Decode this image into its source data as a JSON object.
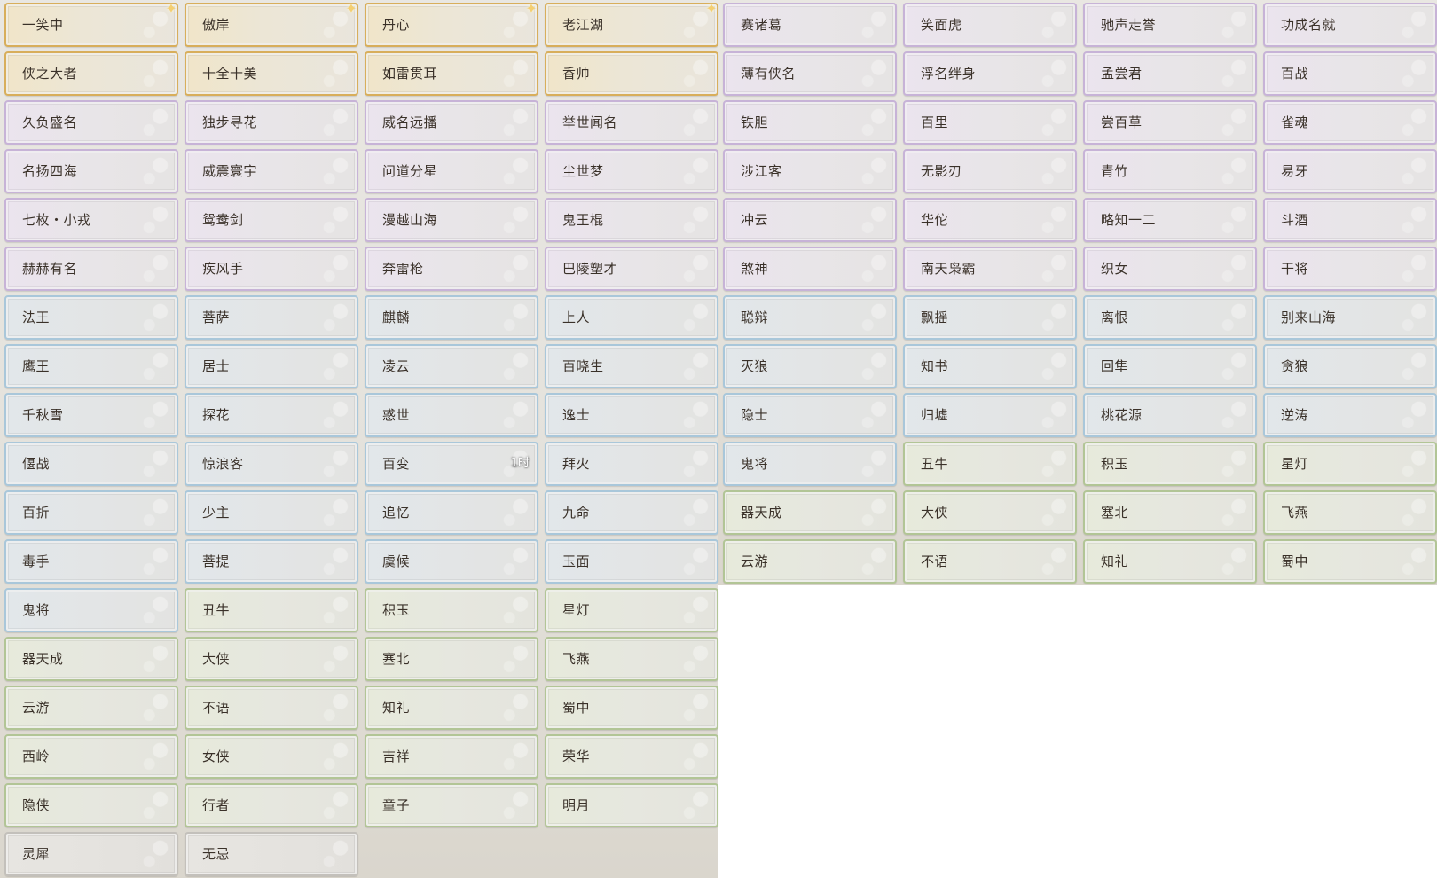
{
  "panels": {
    "left": [
      "一笑中",
      "傲岸",
      "丹心",
      "老江湖",
      "侠之大者",
      "十全十美",
      "如雷贯耳",
      "香帅",
      "久负盛名",
      "独步寻花",
      "威名远播",
      "举世闻名",
      "名扬四海",
      "威震寰宇",
      "问道分星",
      "尘世梦",
      "七枚・小戎",
      "鸳鸯剑",
      "漫越山海",
      "鬼王棍",
      "赫赫有名",
      "疾风手",
      "奔雷枪",
      "巴陵塑才",
      "法王",
      "菩萨",
      "麒麟",
      "上人",
      "鹰王",
      "居士",
      "凌云",
      "百晓生",
      "千秋雪",
      "探花",
      "惑世",
      "逸士",
      "偃战",
      "惊浪客",
      "百变",
      "拜火",
      "百折",
      "少主",
      "追忆",
      "九命",
      "毒手",
      "菩提",
      "虞候",
      "玉面",
      "鬼将",
      "丑牛",
      "积玉",
      "星灯",
      "器天成",
      "大侠",
      "塞北",
      "飞燕",
      "云游",
      "不语",
      "知礼",
      "蜀中",
      "西岭",
      "女侠",
      "吉祥",
      "荣华",
      "隐侠",
      "行者",
      "童子",
      "明月",
      "灵犀",
      "无忌"
    ],
    "right": [
      "赛诸葛",
      "笑面虎",
      "驰声走誉",
      "功成名就",
      "薄有侠名",
      "浮名绊身",
      "孟尝君",
      "百战",
      "铁胆",
      "百里",
      "尝百草",
      "雀魂",
      "涉江客",
      "无影刃",
      "青竹",
      "易牙",
      "冲云",
      "华佗",
      "略知一二",
      "斗酒",
      "煞神",
      "南天枭霸",
      "织女",
      "干将",
      "聪辩",
      "飘摇",
      "离恨",
      "别来山海",
      "灭狼",
      "知书",
      "回隼",
      "贪狼",
      "隐士",
      "归墟",
      "桃花源",
      "逆涛",
      "鬼将",
      "丑牛",
      "积玉",
      "星灯",
      "器天成",
      "大侠",
      "塞北",
      "飞燕",
      "云游",
      "不语",
      "知礼",
      "蜀中"
    ]
  },
  "special": {
    "starred_left": [
      "一笑中",
      "傲岸",
      "丹心",
      "老江湖"
    ],
    "timer_label": "1时",
    "timer_on": "百变"
  },
  "tiers": {
    "left_rows": [
      "gold",
      "gold",
      "purple",
      "purple",
      "purple",
      "purple",
      "blue",
      "blue",
      "blue",
      "blue",
      "blue",
      "blue",
      "mixed_blue_green",
      "green",
      "green",
      "green",
      "green",
      "gray"
    ],
    "right_rows": [
      "purple",
      "purple",
      "purple",
      "purple",
      "purple",
      "purple",
      "blue",
      "blue",
      "blue",
      "mixed_blue_green",
      "green",
      "green"
    ]
  },
  "colors": {
    "gold": "#d8ae5b",
    "purple": "#c7b3d7",
    "blue": "#a9c7da",
    "green": "#b2c596",
    "gray": "#c3c0bb",
    "text": "#3a3129"
  }
}
